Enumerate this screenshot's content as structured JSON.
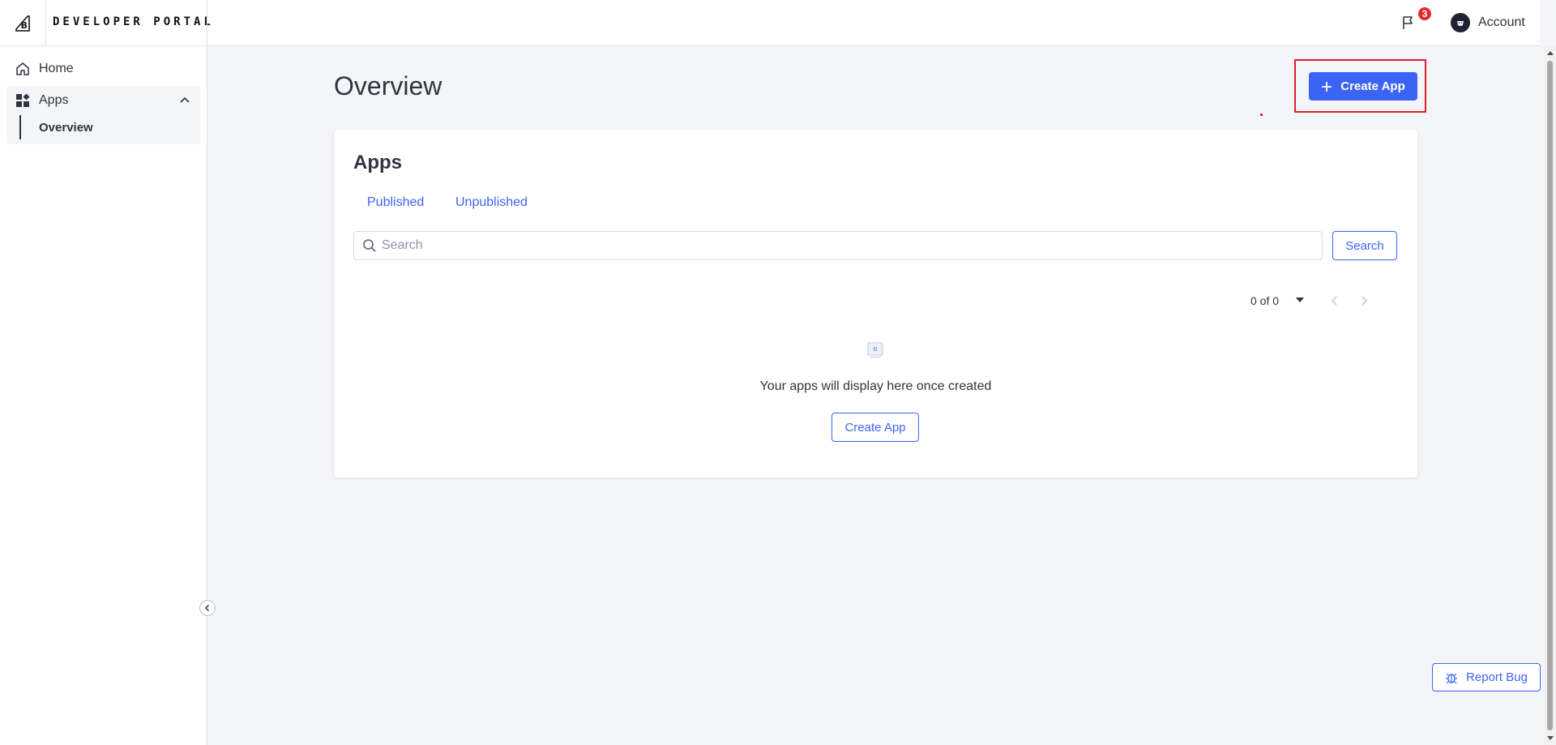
{
  "header": {
    "brand_title": "DEVELOPER PORTAL",
    "notifications_count": "3",
    "account_label": "Account"
  },
  "sidebar": {
    "home_label": "Home",
    "apps_label": "Apps",
    "overview_label": "Overview"
  },
  "main": {
    "page_title": "Overview",
    "create_app_label": "Create App"
  },
  "apps_card": {
    "title": "Apps",
    "tabs": [
      "Published",
      "Unpublished"
    ],
    "search_placeholder": "Search",
    "search_button": "Search",
    "pagination_text": "0 of 0",
    "empty_message": "Your apps will display here once created",
    "empty_create_label": "Create App"
  },
  "footer": {
    "report_bug_label": "Report Bug"
  },
  "colors": {
    "accent": "#3c64f4",
    "badge": "#e0282d",
    "highlight": "#e0202a"
  }
}
